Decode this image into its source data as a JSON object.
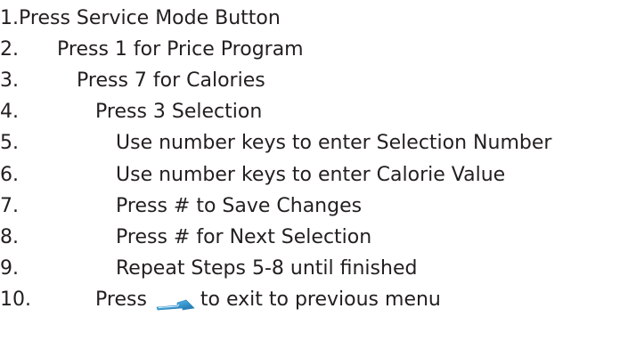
{
  "steps": [
    {
      "number": "1.",
      "text": "Press Service Mode Button"
    },
    {
      "number": "2.",
      "text": "Press 1 for Price Program"
    },
    {
      "number": "3.",
      "text": "Press 7 for Calories"
    },
    {
      "number": "4.",
      "text": "Press 3 Selection"
    },
    {
      "number": "5.",
      "text": "Use number keys to enter Selection Number"
    },
    {
      "number": "6.",
      "text": "Use number keys to enter Calorie Value"
    },
    {
      "number": "7.",
      "text": "Press # to Save Changes"
    },
    {
      "number": "8.",
      "text": "Press # for Next Selection"
    },
    {
      "number": "9.",
      "text": "Repeat Steps 5-8 until finished"
    },
    {
      "number": "10.",
      "text_before": "Press",
      "icon": "back-arrow-icon",
      "text_after": "to exit to previous menu"
    }
  ]
}
